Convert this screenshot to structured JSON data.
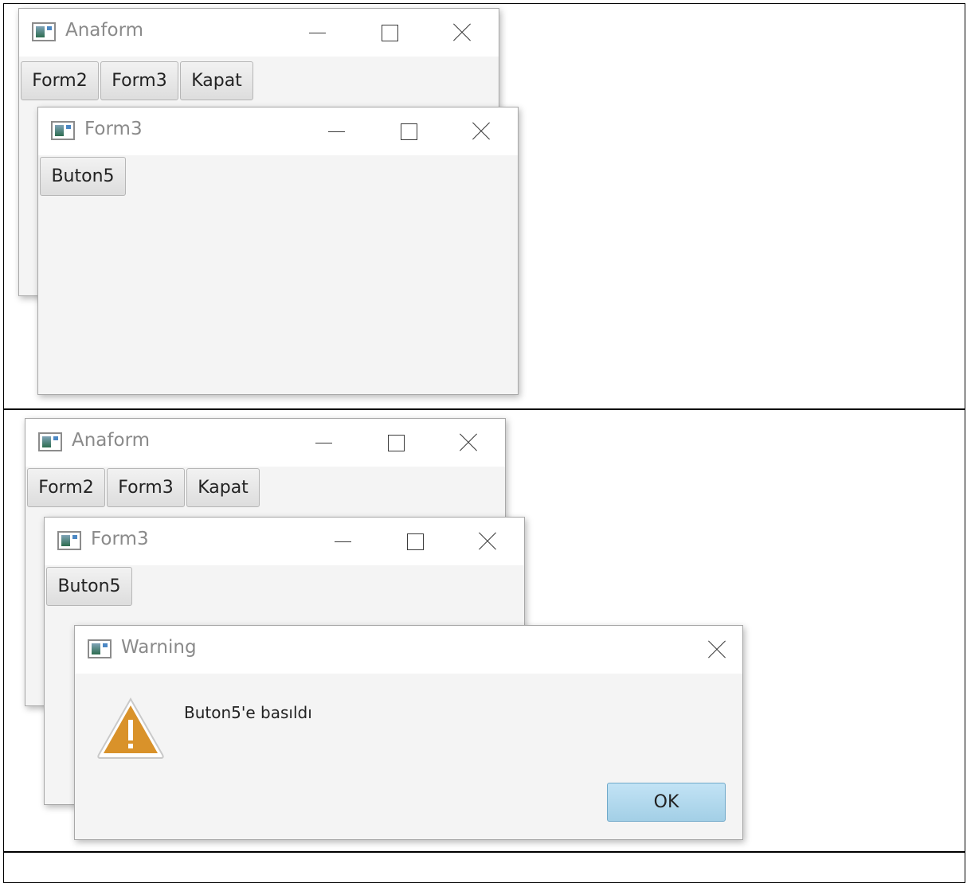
{
  "screenshot_top": {
    "main_window": {
      "title": "Anaform",
      "buttons": [
        "Form2",
        "Form3",
        "Kapat"
      ]
    },
    "child_window": {
      "title": "Form3",
      "button": "Buton5"
    }
  },
  "screenshot_bottom": {
    "main_window": {
      "title": "Anaform",
      "buttons": [
        "Form2",
        "Form3",
        "Kapat"
      ]
    },
    "child_window": {
      "title": "Form3",
      "button": "Buton5"
    },
    "dialog": {
      "title": "Warning",
      "icon": "warning-icon",
      "message": "Buton5'e basıldı",
      "ok_label": "OK"
    }
  },
  "colors": {
    "window_bg": "#f4f4f4",
    "title_text": "#8a8a8a",
    "ok_button": "#a9d4ea",
    "warning_fill": "#d9922a"
  }
}
